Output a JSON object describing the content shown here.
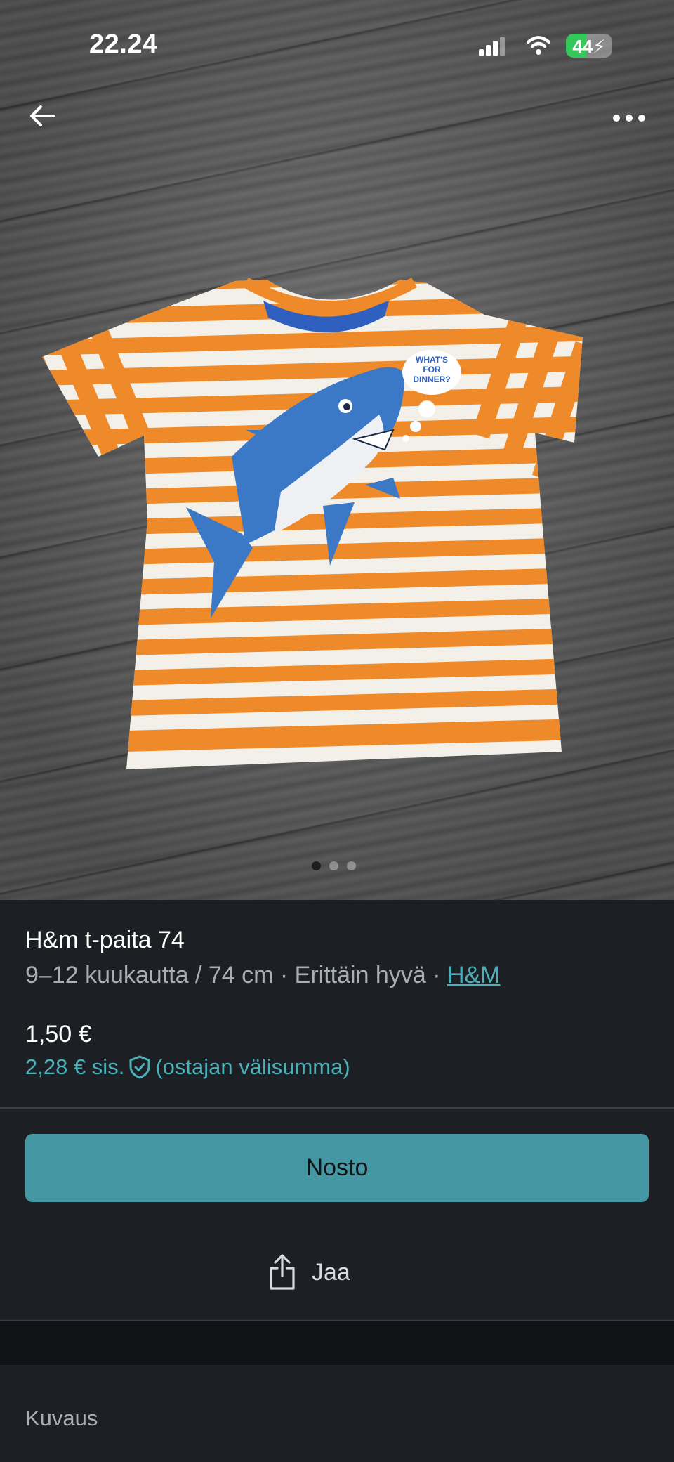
{
  "status_bar": {
    "time": "22.24",
    "battery": "44",
    "battery_level": 0.44
  },
  "gallery": {
    "image_count": 3,
    "active_index": 0
  },
  "item": {
    "title": "H&m t-paita 74",
    "size": "9–12 kuukautta / 74 cm",
    "separator": " · ",
    "condition": "Erittäin hyvä",
    "brand": "H&M",
    "price": "1,50 €",
    "price_incl": "2,28 € sis.",
    "price_incl_note": "(ostajan välisumma)"
  },
  "actions": {
    "buy_label": "Nosto",
    "share_label": "Jaa"
  },
  "description": {
    "label": "Kuvaus"
  },
  "shirt_print": {
    "line1": "WHAT'S",
    "line2": "FOR",
    "line3": "DINNER?"
  },
  "colors": {
    "accent": "#4598a3",
    "link": "#4ab0ba",
    "background": "#1c2024"
  }
}
